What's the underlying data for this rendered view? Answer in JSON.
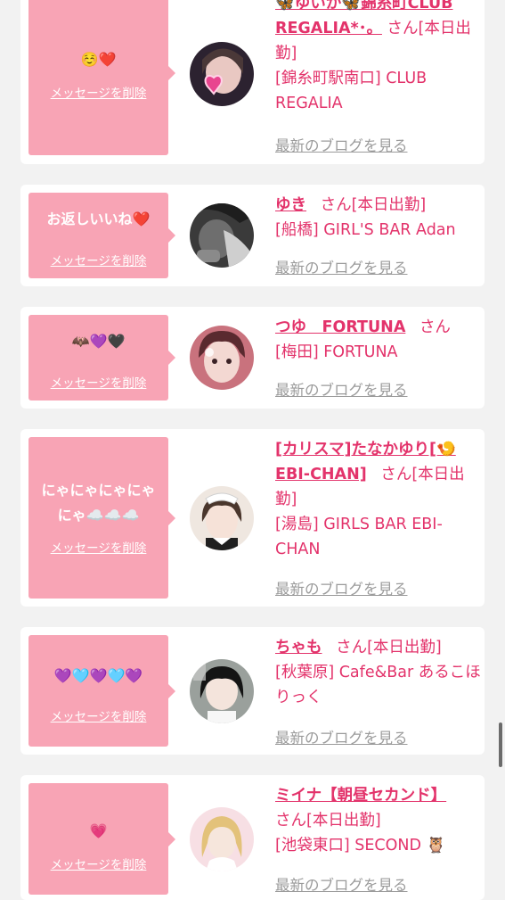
{
  "cards": [
    {
      "message": "☺️❤️",
      "delete_label": "メッセージを削除",
      "name": "🦋ゆいか🦋錦糸町CLUB REGALIA*･。",
      "suffix": "さん[本日出勤]",
      "shop": "[錦糸町駅南口] CLUB REGALIA",
      "blog_label": "最新のブログを見る",
      "avatar_icon": "girl-with-heart-avatar"
    },
    {
      "message": "お返しいいね❤️",
      "delete_label": "メッセージを削除",
      "name": "ゆき",
      "suffix": "さん[本日出勤]",
      "shop": "[船橋] GIRL'S BAR Adan",
      "blog_label": "最新のブログを見る",
      "avatar_icon": "dark-photo-avatar"
    },
    {
      "message": "🦇💜🖤",
      "delete_label": "メッセージを削除",
      "name": "つゆ　FORTUNA",
      "suffix": "さん",
      "shop": "[梅田] FORTUNA",
      "blog_label": "最新のブログを見る",
      "avatar_icon": "girl-portrait-avatar"
    },
    {
      "message": "にゃにゃにゃにゃにゃ☁️☁️☁️",
      "delete_label": "メッセージを削除",
      "name": "[カリスマ]たなかゆり[🍤EBI-CHAN]",
      "suffix": "さん[本日出勤]",
      "shop": "[湯島] GIRLS BAR EBI-CHAN",
      "blog_label": "最新のブログを見る",
      "avatar_icon": "maid-costume-avatar"
    },
    {
      "message": "💜🩵💜🩵💜",
      "delete_label": "メッセージを削除",
      "name": "ちゃも",
      "suffix": "さん[本日出勤]",
      "shop": "[秋葉原] Cafe&Bar あるこほりっく",
      "blog_label": "最新のブログを見る",
      "avatar_icon": "girl-selfie-avatar"
    },
    {
      "message": "💗",
      "delete_label": "メッセージを削除",
      "name": "ミイナ【朝昼セカンド】",
      "suffix": "さん[本日出勤]",
      "shop": "[池袋東口] SECOND 🦉",
      "blog_label": "最新のブログを見る",
      "avatar_icon": "blonde-girl-avatar"
    }
  ],
  "colors": {
    "accent": "#e3336b",
    "bubble": "#f8a4b5",
    "link_gray": "#9b9b9b",
    "background": "#f2f2f2"
  }
}
